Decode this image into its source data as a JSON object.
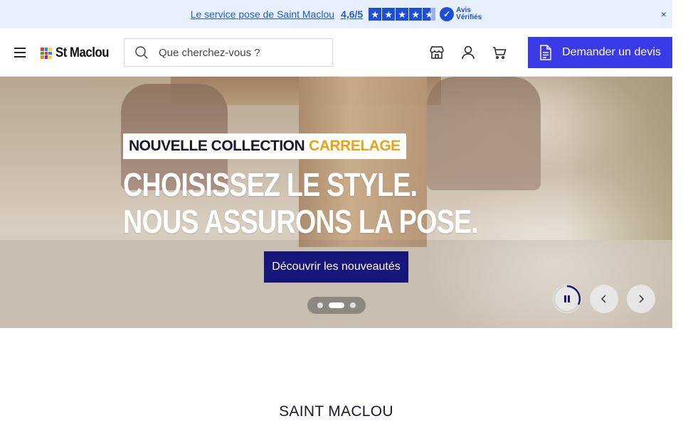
{
  "promo": {
    "link_text": "Le service pose de Saint Maclou",
    "rating": "4,6/5",
    "stars": 4.6,
    "avis_line1": "Avis",
    "avis_line2": "Vérifiés",
    "close": "×"
  },
  "header": {
    "logo_text": "St Maclou",
    "search_placeholder": "Que cherchez-vous ?",
    "cta_label": "Demander un devis",
    "icons": [
      "menu-icon",
      "store-icon",
      "account-icon",
      "cart-icon"
    ]
  },
  "hero": {
    "tag_main": "NOUVELLE COLLECTION",
    "tag_highlight": "CARRELAGE",
    "headline_line1": "CHOISISSEZ LE STYLE.",
    "headline_line2": "NOUS ASSURONS LA POSE.",
    "button_label": "Découvrir les nouveautés",
    "slides_count": 3,
    "active_slide": 2
  },
  "colors": {
    "promo_bg": "#e8f0fe",
    "cta": "#3a3ae6",
    "hero_button": "#16167a",
    "highlight": "#e8a316"
  },
  "section": {
    "title": "SAINT MACLOU"
  }
}
